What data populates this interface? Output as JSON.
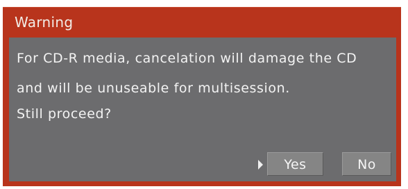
{
  "dialog": {
    "title": "Warning",
    "message_lines": [
      "For CD-R media, cancelation will damage the CD",
      "and will be unuseable for multisession.",
      "Still proceed?"
    ],
    "buttons": {
      "yes_label": "Yes",
      "no_label": "No",
      "selected": "Yes"
    },
    "selection_cursor_icon": "triangle-right-icon"
  },
  "colors": {
    "frame": "#b8341c",
    "body": "#6c6c6e",
    "button": "#858585",
    "text": "#f3f3f3"
  }
}
